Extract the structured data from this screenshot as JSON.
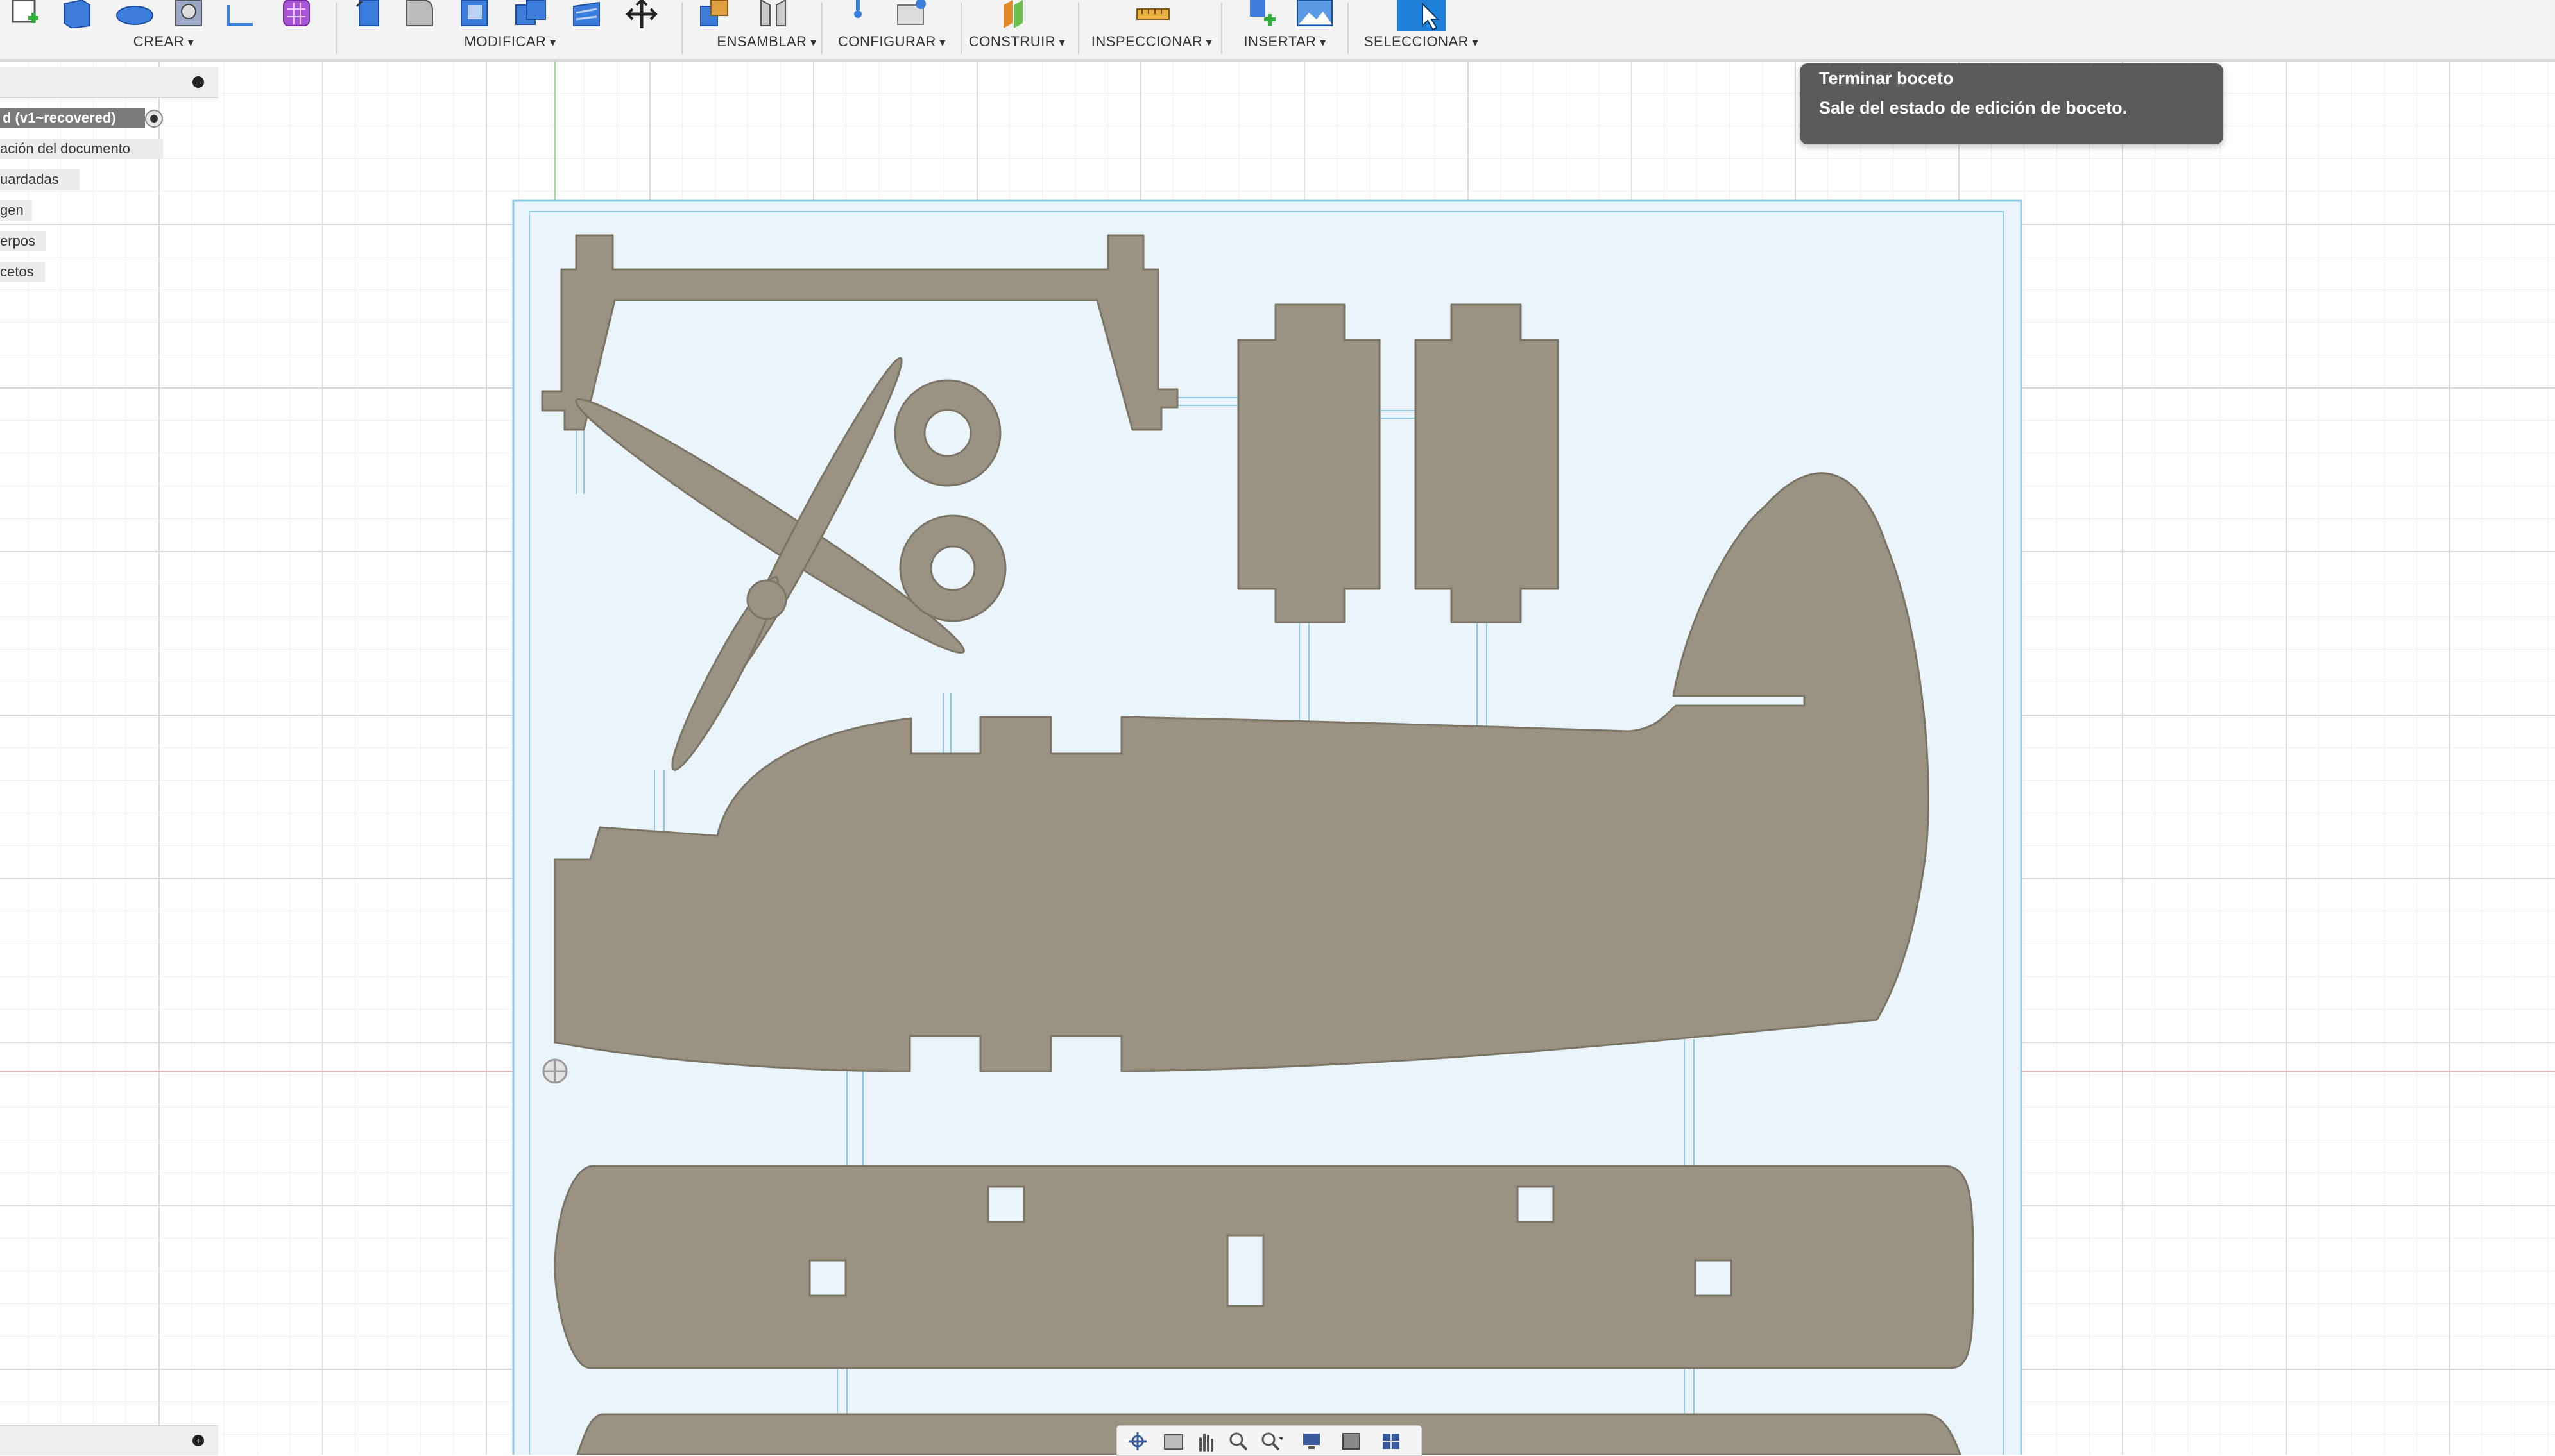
{
  "toolbar": {
    "groups": [
      {
        "id": "crear",
        "label": "CREAR"
      },
      {
        "id": "modificar",
        "label": "MODIFICAR"
      },
      {
        "id": "ensamblar",
        "label": "ENSAMBLAR"
      },
      {
        "id": "configurar",
        "label": "CONFIGURAR"
      },
      {
        "id": "construir",
        "label": "CONSTRUIR"
      },
      {
        "id": "inspeccionar",
        "label": "INSPECCIONAR"
      },
      {
        "id": "insertar",
        "label": "INSERTAR"
      },
      {
        "id": "seleccionar",
        "label": "SELECCIONAR"
      }
    ]
  },
  "browser": {
    "items": [
      {
        "label": "d (v1~recovered)",
        "active": true
      },
      {
        "label": "ación del documento"
      },
      {
        "label": "uardadas"
      },
      {
        "label": "gen"
      },
      {
        "label": "erpos"
      },
      {
        "label": "cetos"
      }
    ]
  },
  "tooltip": {
    "title": "Terminar boceto",
    "description": "Sale del estado de edición de boceto."
  },
  "navbar": {
    "icons": [
      "orbit-icon",
      "look-at-icon",
      "pan-icon",
      "zoom-icon",
      "fit-icon",
      "display-settings-icon",
      "visual-style-icon",
      "grid-settings-icon"
    ]
  },
  "colors": {
    "part_fill": "#9a9282",
    "part_stroke": "#7c7465",
    "sketch_line": "#8ecae6",
    "sketch_fill": "#eaf4fb",
    "toolbar_bg": "#f3f3f3",
    "tooltip_bg": "#5b5b5b"
  }
}
